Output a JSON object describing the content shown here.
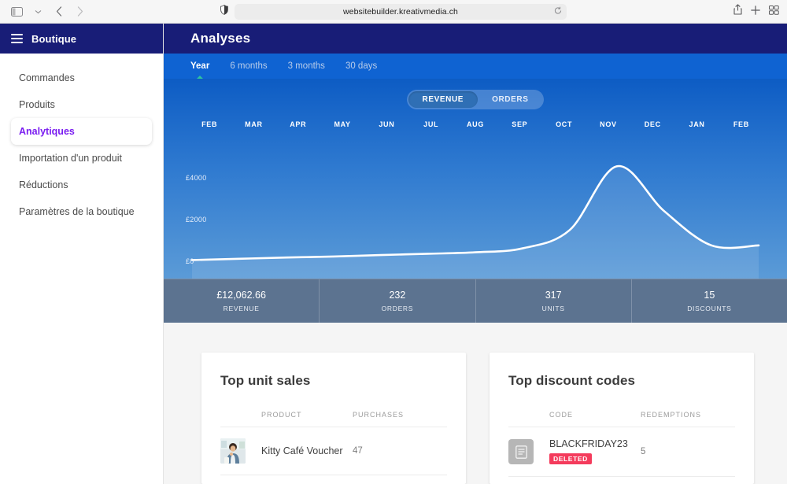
{
  "browser": {
    "url": "websitebuilder.kreativmedia.ch",
    "icons": {
      "sidebar_toggle": "sidebar-toggle-icon",
      "chevron_down": "chevron-down-icon",
      "back": "back-arrow-icon",
      "forward": "forward-arrow-icon",
      "shield": "shield-icon",
      "reload": "reload-icon",
      "share": "share-icon",
      "new_tab": "plus-icon",
      "tab_overview": "tab-overview-icon"
    }
  },
  "sidebar": {
    "brand": "Boutique",
    "items": [
      {
        "label": "Commandes",
        "active": false
      },
      {
        "label": "Produits",
        "active": false
      },
      {
        "label": "Analytiques",
        "active": true
      },
      {
        "label": "Importation d'un produit",
        "active": false
      },
      {
        "label": "Réductions",
        "active": false
      },
      {
        "label": "Paramètres de la boutique",
        "active": false
      }
    ]
  },
  "header": {
    "title": "Analyses"
  },
  "tabs": [
    {
      "label": "Year",
      "active": true
    },
    {
      "label": "6 months",
      "active": false
    },
    {
      "label": "3 months",
      "active": false
    },
    {
      "label": "30 days",
      "active": false
    }
  ],
  "segmented": [
    {
      "label": "REVENUE",
      "active": true
    },
    {
      "label": "ORDERS",
      "active": false
    }
  ],
  "chart_data": {
    "type": "area",
    "title": "",
    "xlabel": "",
    "ylabel": "",
    "categories": [
      "FEB",
      "MAR",
      "APR",
      "MAY",
      "JUN",
      "JUL",
      "AUG",
      "SEP",
      "OCT",
      "NOV",
      "DEC",
      "JAN",
      "FEB"
    ],
    "values": [
      60,
      120,
      180,
      230,
      300,
      360,
      430,
      620,
      1500,
      4550,
      2400,
      760,
      760
    ],
    "ytick_labels": [
      "£4000",
      "£2000",
      "£0"
    ],
    "ytick_values": [
      4000,
      2000,
      0
    ],
    "ylim": [
      0,
      5200
    ],
    "grid": false,
    "legend": "none",
    "series_name": "REVENUE",
    "currency": "£",
    "line_color": "#ffffff",
    "fill_color": "rgba(255,255,255,0.10)",
    "background_top": "#0d5cc4",
    "background_bottom": "#5b9bd7"
  },
  "stats": [
    {
      "value": "£12,062.66",
      "label": "REVENUE"
    },
    {
      "value": "232",
      "label": "ORDERS"
    },
    {
      "value": "317",
      "label": "UNITS"
    },
    {
      "value": "15",
      "label": "DISCOUNTS"
    }
  ],
  "cards": {
    "unit_sales": {
      "title": "Top unit sales",
      "columns": {
        "thumb": "",
        "product": "PRODUCT",
        "purchases": "PURCHASES"
      },
      "rows": [
        {
          "name": "Kitty Café Voucher",
          "purchases": "47",
          "thumb": "product-photo"
        }
      ]
    },
    "discount_codes": {
      "title": "Top discount codes",
      "columns": {
        "icon": "",
        "code": "CODE",
        "redemptions": "REDEMPTIONS"
      },
      "rows": [
        {
          "code": "BLACKFRIDAY23",
          "badge": "DELETED",
          "redemptions": "5",
          "icon": "document-icon"
        }
      ]
    }
  },
  "colors": {
    "navy": "#181d77",
    "accent_purple": "#7a1df0",
    "tab_blue": "#0f63d2",
    "indicator_green": "#2ec4a0",
    "stats_bg": "#5c7390",
    "badge_red": "#f43b5c"
  }
}
